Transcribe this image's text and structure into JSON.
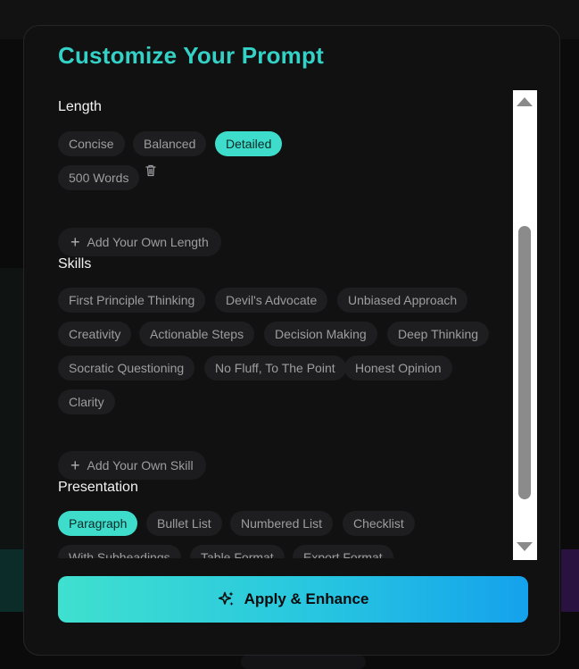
{
  "modal": {
    "title": "Customize Your Prompt",
    "apply_label": "Apply & Enhance"
  },
  "length": {
    "title": "Length",
    "options": [
      "Concise",
      "Balanced",
      "Detailed"
    ],
    "active": "Detailed",
    "custom": [
      "500 Words"
    ],
    "add_label": "Add Your Own Length"
  },
  "skills": {
    "title": "Skills",
    "options": [
      "First Principle Thinking",
      "Devil's Advocate",
      "Unbiased Approach",
      "Creativity",
      "Actionable Steps",
      "Decision Making",
      "Deep Thinking",
      "Socratic Questioning",
      "No Fluff, To The Point",
      "Honest Opinion",
      "Clarity"
    ],
    "add_label": "Add Your Own Skill"
  },
  "presentation": {
    "title": "Presentation",
    "options": [
      "Paragraph",
      "Bullet List",
      "Numbered List",
      "Checklist",
      "With Subheadings",
      "Table Format",
      "Export Format"
    ],
    "active": "Paragraph"
  },
  "icons": {
    "trash": "trash-icon",
    "plus": "plus-icon",
    "sparkle": "sparkle-icon"
  },
  "colors": {
    "accent": "#34d1c6",
    "chip_active": "#3ddccb",
    "chip_bg": "#1e1e20",
    "button_gradient_start": "#3fe0cf",
    "button_gradient_end": "#14a2ec"
  }
}
